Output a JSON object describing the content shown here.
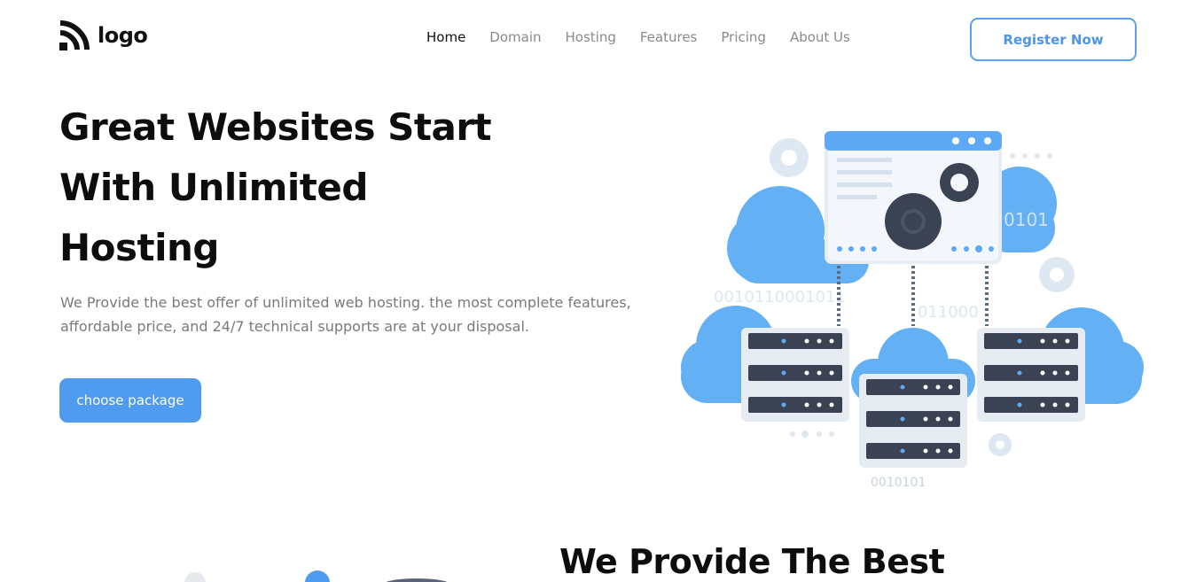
{
  "header": {
    "logo_text": "logo",
    "nav": [
      {
        "label": "Home",
        "active": true
      },
      {
        "label": "Domain",
        "active": false
      },
      {
        "label": "Hosting",
        "active": false
      },
      {
        "label": "Features",
        "active": false
      },
      {
        "label": "Pricing",
        "active": false
      },
      {
        "label": "About Us",
        "active": false
      }
    ],
    "register_label": "Register Now"
  },
  "hero": {
    "title_lines": [
      "Great Websites Start",
      "With Unlimited",
      "Hosting"
    ],
    "description": "We Provide the best offer of unlimited web hosting. the most complete features, affordable price, and 24/7 technical supports are at your disposal.",
    "cta_label": "choose package"
  },
  "illustration": {
    "binary_texts": [
      "0101",
      "0010110001011",
      "011000",
      "0010101"
    ],
    "icon": "cloud-server-hosting-illustration"
  },
  "section2": {
    "title": "We Provide The Best"
  },
  "colors": {
    "accent": "#4e9bf0",
    "cloud": "#63b0f5",
    "server_dark": "#3a4253",
    "text_muted": "#7a7a7a"
  }
}
